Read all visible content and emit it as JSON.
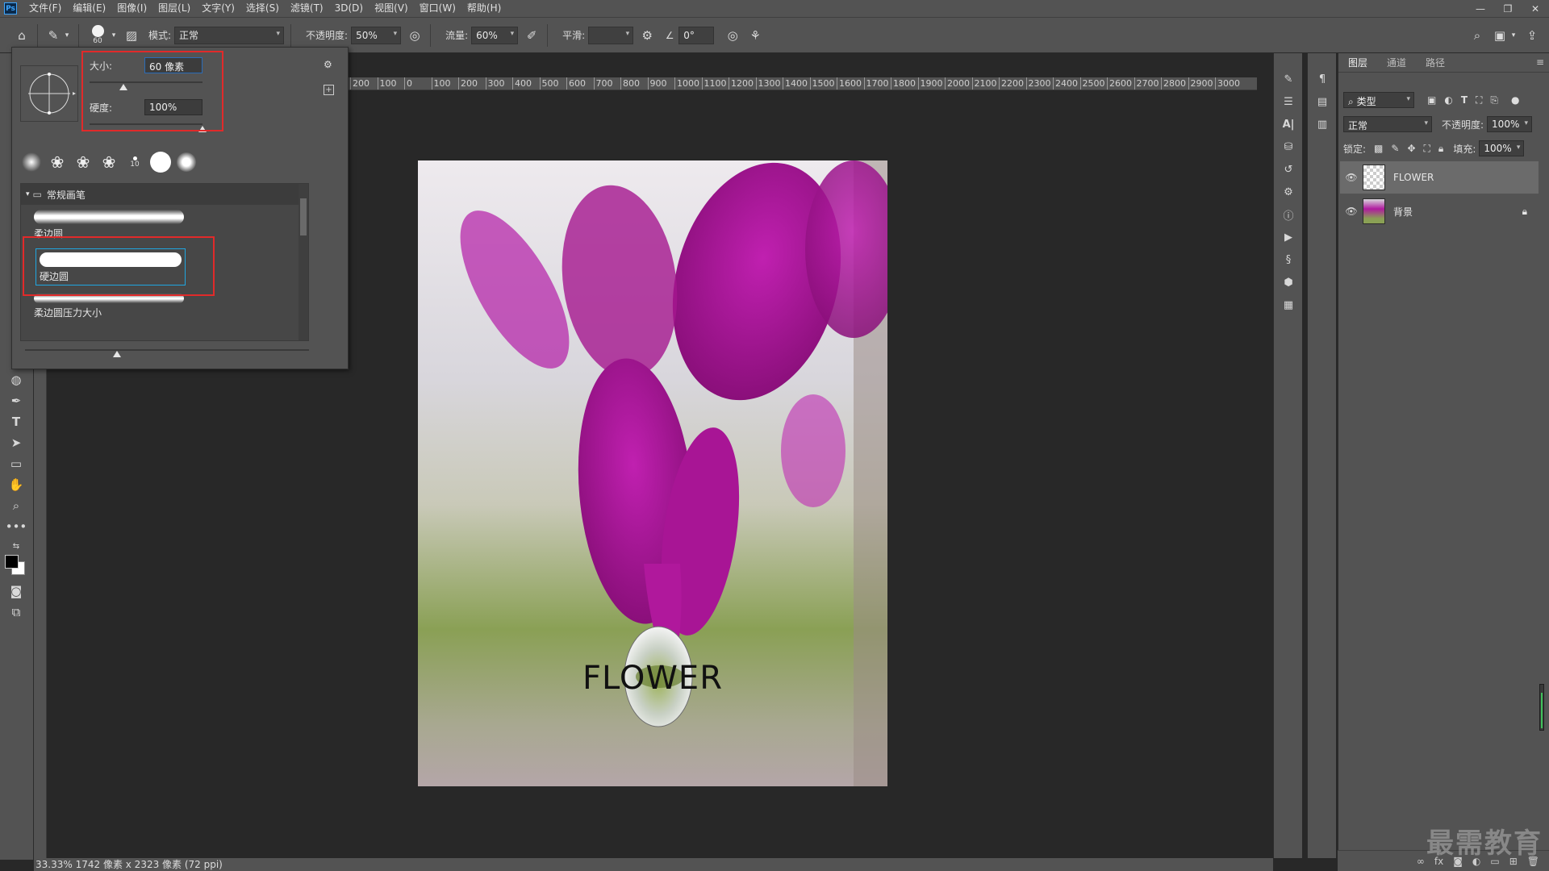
{
  "app": {
    "logo": "Ps",
    "menu": [
      "文件(F)",
      "编辑(E)",
      "图像(I)",
      "图层(L)",
      "文字(Y)",
      "选择(S)",
      "滤镜(T)",
      "3D(D)",
      "视图(V)",
      "窗口(W)",
      "帮助(H)"
    ]
  },
  "options": {
    "brush_size_badge": "60",
    "mode_label": "模式:",
    "mode_value": "正常",
    "opacity_label": "不透明度:",
    "opacity_value": "50%",
    "flow_label": "流量:",
    "flow_value": "60%",
    "smooth_label": "平滑:",
    "smooth_value": "",
    "angle_value": "0°"
  },
  "brush_popup": {
    "size_label": "大小:",
    "size_value": "60 像素",
    "size_level": 0.3,
    "hardness_label": "硬度:",
    "hardness_value": "100%",
    "hardness_level": 1.0,
    "preset_badge": "10",
    "group_name": "常规画笔",
    "brushes": [
      {
        "name": "柔边圆",
        "selected": false
      },
      {
        "name": "硬边圆",
        "selected": true
      },
      {
        "name": "柔边圆压力大小",
        "selected": false
      }
    ]
  },
  "rulers": {
    "horizontal": [
      "200",
      "100",
      "0",
      "100",
      "200",
      "300",
      "400",
      "500",
      "600",
      "700",
      "800",
      "900",
      "1000",
      "1100",
      "1200",
      "1300",
      "1400",
      "1500",
      "1600",
      "1700",
      "1800",
      "1900",
      "2000",
      "2100",
      "2200",
      "2300",
      "2400",
      "2500",
      "2600",
      "2700",
      "2800",
      "2900",
      "3000"
    ]
  },
  "document": {
    "text": "FLOWER"
  },
  "layers_panel": {
    "tabs": [
      "图层",
      "通道",
      "路径"
    ],
    "filter_label": "类型",
    "blend_mode": "正常",
    "opacity_label": "不透明度:",
    "opacity_value": "100%",
    "lock_label": "锁定:",
    "fill_label": "填充:",
    "fill_value": "100%",
    "layers": [
      {
        "name": "FLOWER",
        "selected": true,
        "locked": false
      },
      {
        "name": "背景",
        "selected": false,
        "locked": true
      }
    ]
  },
  "status": {
    "zoom": "33.33%",
    "doc_info": "1742 像素 x 2323 像素 (72 ppi)"
  },
  "watermark": "最需教育",
  "colors": {
    "chrome": "#535353",
    "canvas_bg": "#282828",
    "highlight": "#e12a2a",
    "selection": "#1fa6e0"
  }
}
